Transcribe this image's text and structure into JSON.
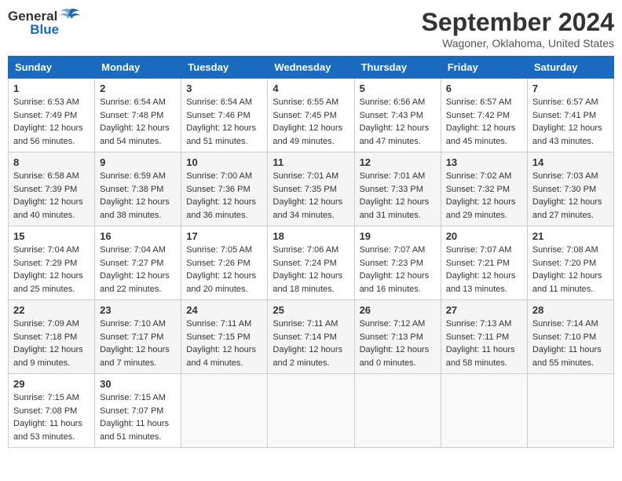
{
  "header": {
    "logo_general": "General",
    "logo_blue": "Blue",
    "title": "September 2024",
    "location": "Wagoner, Oklahoma, United States"
  },
  "weekdays": [
    "Sunday",
    "Monday",
    "Tuesday",
    "Wednesday",
    "Thursday",
    "Friday",
    "Saturday"
  ],
  "weeks": [
    [
      {
        "day": "1",
        "sunrise": "6:53 AM",
        "sunset": "7:49 PM",
        "daylight": "12 hours and 56 minutes."
      },
      {
        "day": "2",
        "sunrise": "6:54 AM",
        "sunset": "7:48 PM",
        "daylight": "12 hours and 54 minutes."
      },
      {
        "day": "3",
        "sunrise": "6:54 AM",
        "sunset": "7:46 PM",
        "daylight": "12 hours and 51 minutes."
      },
      {
        "day": "4",
        "sunrise": "6:55 AM",
        "sunset": "7:45 PM",
        "daylight": "12 hours and 49 minutes."
      },
      {
        "day": "5",
        "sunrise": "6:56 AM",
        "sunset": "7:43 PM",
        "daylight": "12 hours and 47 minutes."
      },
      {
        "day": "6",
        "sunrise": "6:57 AM",
        "sunset": "7:42 PM",
        "daylight": "12 hours and 45 minutes."
      },
      {
        "day": "7",
        "sunrise": "6:57 AM",
        "sunset": "7:41 PM",
        "daylight": "12 hours and 43 minutes."
      }
    ],
    [
      {
        "day": "8",
        "sunrise": "6:58 AM",
        "sunset": "7:39 PM",
        "daylight": "12 hours and 40 minutes."
      },
      {
        "day": "9",
        "sunrise": "6:59 AM",
        "sunset": "7:38 PM",
        "daylight": "12 hours and 38 minutes."
      },
      {
        "day": "10",
        "sunrise": "7:00 AM",
        "sunset": "7:36 PM",
        "daylight": "12 hours and 36 minutes."
      },
      {
        "day": "11",
        "sunrise": "7:01 AM",
        "sunset": "7:35 PM",
        "daylight": "12 hours and 34 minutes."
      },
      {
        "day": "12",
        "sunrise": "7:01 AM",
        "sunset": "7:33 PM",
        "daylight": "12 hours and 31 minutes."
      },
      {
        "day": "13",
        "sunrise": "7:02 AM",
        "sunset": "7:32 PM",
        "daylight": "12 hours and 29 minutes."
      },
      {
        "day": "14",
        "sunrise": "7:03 AM",
        "sunset": "7:30 PM",
        "daylight": "12 hours and 27 minutes."
      }
    ],
    [
      {
        "day": "15",
        "sunrise": "7:04 AM",
        "sunset": "7:29 PM",
        "daylight": "12 hours and 25 minutes."
      },
      {
        "day": "16",
        "sunrise": "7:04 AM",
        "sunset": "7:27 PM",
        "daylight": "12 hours and 22 minutes."
      },
      {
        "day": "17",
        "sunrise": "7:05 AM",
        "sunset": "7:26 PM",
        "daylight": "12 hours and 20 minutes."
      },
      {
        "day": "18",
        "sunrise": "7:06 AM",
        "sunset": "7:24 PM",
        "daylight": "12 hours and 18 minutes."
      },
      {
        "day": "19",
        "sunrise": "7:07 AM",
        "sunset": "7:23 PM",
        "daylight": "12 hours and 16 minutes."
      },
      {
        "day": "20",
        "sunrise": "7:07 AM",
        "sunset": "7:21 PM",
        "daylight": "12 hours and 13 minutes."
      },
      {
        "day": "21",
        "sunrise": "7:08 AM",
        "sunset": "7:20 PM",
        "daylight": "12 hours and 11 minutes."
      }
    ],
    [
      {
        "day": "22",
        "sunrise": "7:09 AM",
        "sunset": "7:18 PM",
        "daylight": "12 hours and 9 minutes."
      },
      {
        "day": "23",
        "sunrise": "7:10 AM",
        "sunset": "7:17 PM",
        "daylight": "12 hours and 7 minutes."
      },
      {
        "day": "24",
        "sunrise": "7:11 AM",
        "sunset": "7:15 PM",
        "daylight": "12 hours and 4 minutes."
      },
      {
        "day": "25",
        "sunrise": "7:11 AM",
        "sunset": "7:14 PM",
        "daylight": "12 hours and 2 minutes."
      },
      {
        "day": "26",
        "sunrise": "7:12 AM",
        "sunset": "7:13 PM",
        "daylight": "12 hours and 0 minutes."
      },
      {
        "day": "27",
        "sunrise": "7:13 AM",
        "sunset": "7:11 PM",
        "daylight": "11 hours and 58 minutes."
      },
      {
        "day": "28",
        "sunrise": "7:14 AM",
        "sunset": "7:10 PM",
        "daylight": "11 hours and 55 minutes."
      }
    ],
    [
      {
        "day": "29",
        "sunrise": "7:15 AM",
        "sunset": "7:08 PM",
        "daylight": "11 hours and 53 minutes."
      },
      {
        "day": "30",
        "sunrise": "7:15 AM",
        "sunset": "7:07 PM",
        "daylight": "11 hours and 51 minutes."
      },
      null,
      null,
      null,
      null,
      null
    ]
  ]
}
